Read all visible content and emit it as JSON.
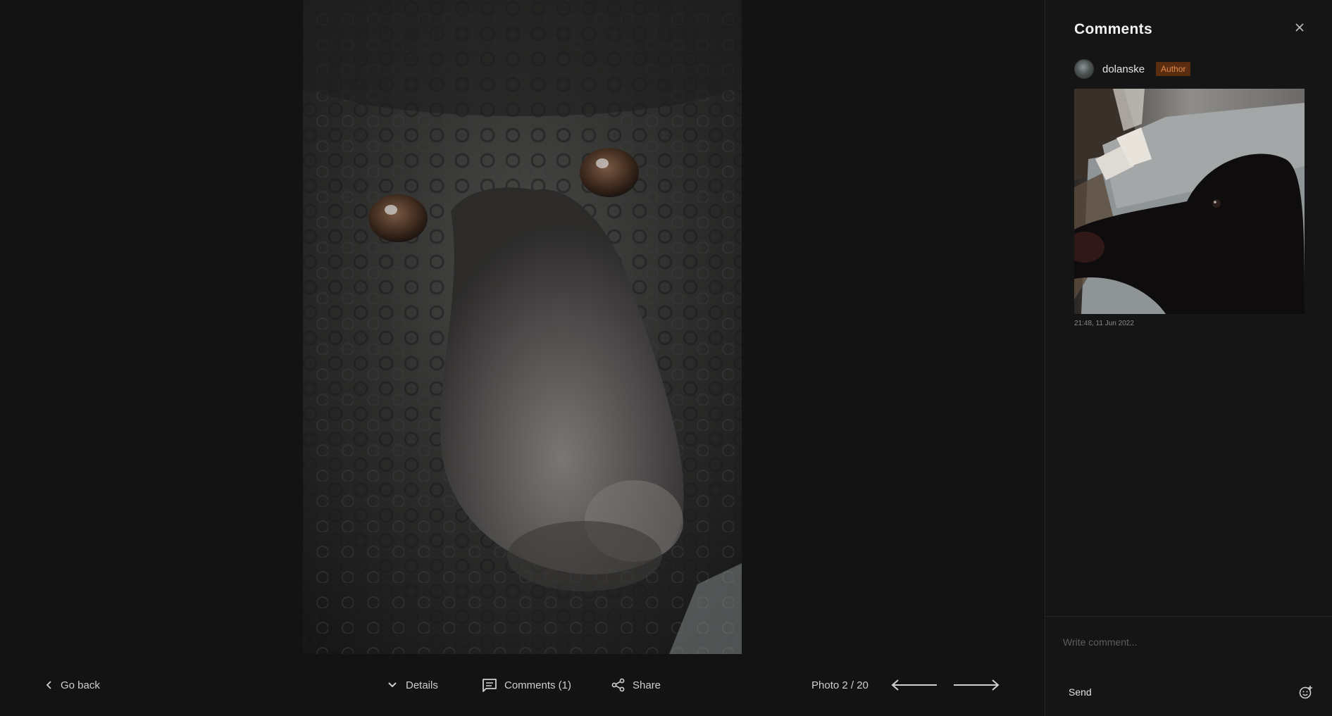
{
  "toolbar": {
    "go_back_label": "Go back",
    "details_label": "Details",
    "comments_label": "Comments (1)",
    "share_label": "Share",
    "photo_counter": "Photo 2 / 20"
  },
  "comments_panel": {
    "title": "Comments",
    "comments": [
      {
        "username": "dolanske",
        "badge": "Author",
        "timestamp": "21:48, 11 Jun 2022"
      }
    ],
    "compose": {
      "placeholder": "Write comment...",
      "send_label": "Send"
    }
  },
  "colors": {
    "background": "#131313",
    "panel_background": "#151515",
    "badge_background": "#5a2d10",
    "badge_text": "#e08a4a"
  },
  "icons": {
    "go_back": "chevron-left-icon",
    "details": "chevron-down-icon",
    "comments": "comment-icon",
    "share": "share-icon",
    "prev": "arrow-left-icon",
    "next": "arrow-right-icon",
    "close": "close-icon",
    "emoji": "emoji-add-icon"
  }
}
